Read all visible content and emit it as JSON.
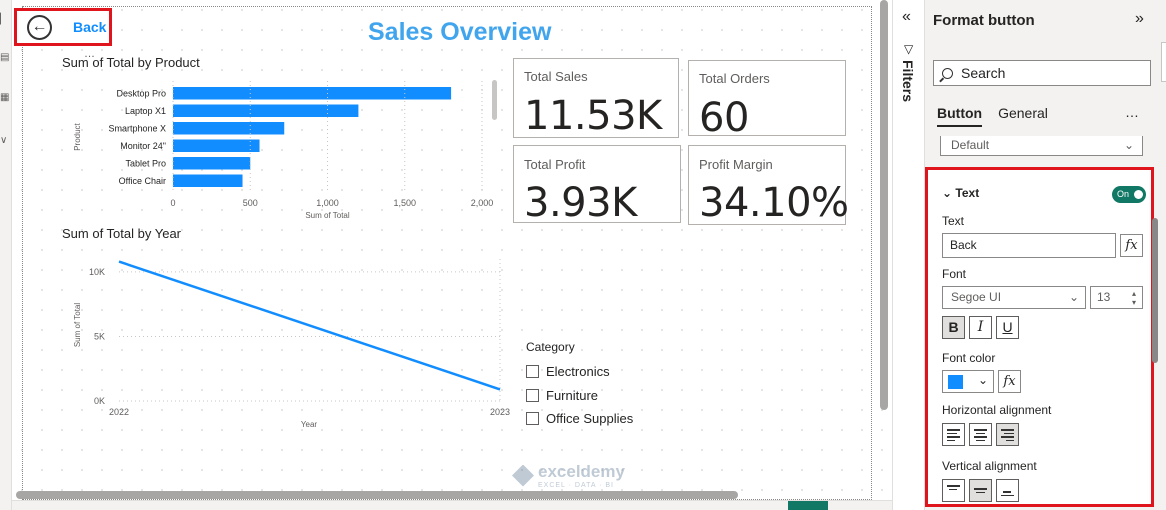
{
  "canvas": {
    "report_title": "Sales Overview",
    "back_button": {
      "label": "Back"
    },
    "more_options": "…",
    "bar_chart": {
      "title": "Sum of Total by Product",
      "ylabel": "Product",
      "xlabel": "Sum of Total",
      "ticks": [
        "0",
        "500",
        "1,000",
        "1,500",
        "2,000"
      ]
    },
    "line_chart": {
      "title": "Sum of Total by Year",
      "ylabel": "Sum of Total",
      "xlabel": "Year",
      "yticks": [
        "10K",
        "5K",
        "0K"
      ],
      "xticks": [
        "2022",
        "2023"
      ]
    },
    "cards": [
      {
        "label": "Total Sales",
        "value": "11.53K"
      },
      {
        "label": "Total Orders",
        "value": "60"
      },
      {
        "label": "Total Profit",
        "value": "3.93K"
      },
      {
        "label": "Profit Margin",
        "value": "34.10%"
      }
    ],
    "slicer": {
      "header": "Category",
      "options": [
        "Electronics",
        "Furniture",
        "Office Supplies"
      ]
    },
    "watermark": {
      "name": "exceldemy",
      "tagline": "EXCEL · DATA · BI"
    }
  },
  "chart_data": [
    {
      "type": "bar",
      "title": "Sum of Total by Product",
      "xlabel": "Sum of Total",
      "ylabel": "Product",
      "categories": [
        "Desktop Pro",
        "Laptop X1",
        "Smartphone X",
        "Monitor 24\"",
        "Tablet Pro",
        "Office Chair"
      ],
      "values": [
        1800,
        1200,
        720,
        560,
        500,
        450
      ],
      "xlim": [
        0,
        2000
      ],
      "color": "#118dff"
    },
    {
      "type": "line",
      "title": "Sum of Total by Year",
      "xlabel": "Year",
      "ylabel": "Sum of Total",
      "x": [
        2022,
        2023
      ],
      "values": [
        10800,
        900
      ],
      "ylim": [
        0,
        11000
      ],
      "color": "#118dff"
    }
  ],
  "filters_pane": {
    "label": "Filters"
  },
  "format_pane": {
    "title": "Format button",
    "search_placeholder": "Search",
    "tabs": [
      "Button",
      "General"
    ],
    "more": "…",
    "state_select": "Default",
    "text_section": {
      "header": "Text",
      "toggle": "On",
      "text_label": "Text",
      "text_value": "Back",
      "font_label": "Font",
      "font_family": "Segoe UI",
      "font_size": "13",
      "bold": "B",
      "italic": "I",
      "underline": "U",
      "font_color_label": "Font color",
      "font_color": "#118dff",
      "horizontal_alignment_label": "Horizontal alignment",
      "vertical_alignment_label": "Vertical alignment"
    }
  }
}
